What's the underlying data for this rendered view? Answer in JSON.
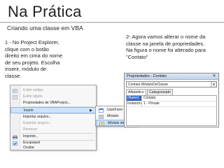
{
  "slide": {
    "title": "Na Prática",
    "subtitle": "Criando uma classe em VBA",
    "note_left": "1 - No Project Explorer, clique com o botão direito em cima do nome de seu projeto. Escolha inserir, módulo de classe.",
    "note_right": "2- Agora vamos alterar o nome da classe na janela de propriedades. Na figura o nome foi alterado para \"Contato\""
  },
  "context_menu": {
    "items": [
      {
        "label": "Exibir código",
        "icon": "code-icon",
        "disabled": true
      },
      {
        "label": "Exibir objeto",
        "icon": "object-icon",
        "disabled": true
      },
      {
        "label": "Propriedades de VBAProject...",
        "icon": "",
        "disabled": false
      },
      {
        "label": "Inserir",
        "icon": "",
        "disabled": false,
        "highlight": true,
        "has_submenu": true
      },
      {
        "label": "Importar arquivo...",
        "icon": "",
        "disabled": false
      },
      {
        "label": "Exportar arquivo...",
        "icon": "",
        "disabled": true
      },
      {
        "label": "Remover",
        "icon": "",
        "disabled": true
      },
      {
        "label": "Imprimir...",
        "icon": "printer-icon",
        "disabled": false
      },
      {
        "label": "Encaixável",
        "icon": "check-icon",
        "disabled": false
      },
      {
        "label": "Ocultar",
        "icon": "",
        "disabled": false
      }
    ],
    "submenu": [
      {
        "label": "UserForm",
        "icon": "userform-icon"
      },
      {
        "label": "Módulo",
        "icon": "module-icon"
      },
      {
        "label": "Módulo de classe",
        "icon": "class-module-icon",
        "highlight": true
      }
    ]
  },
  "properties_window": {
    "title": "Propriedades - Contato",
    "object_combo": "Contato  MóduloDeClasse",
    "tabs": [
      "Alfabético",
      "Categorizado"
    ],
    "active_tab": 0,
    "rows": [
      {
        "name": "(Name)",
        "value": "Contato",
        "selected": true
      },
      {
        "name": "Instancing",
        "value": "1 - Private",
        "selected": false
      }
    ]
  },
  "colors": {
    "accent": "#3465c6",
    "highlight": "#cfe3f7",
    "title_rule": "#c9c9c9"
  }
}
